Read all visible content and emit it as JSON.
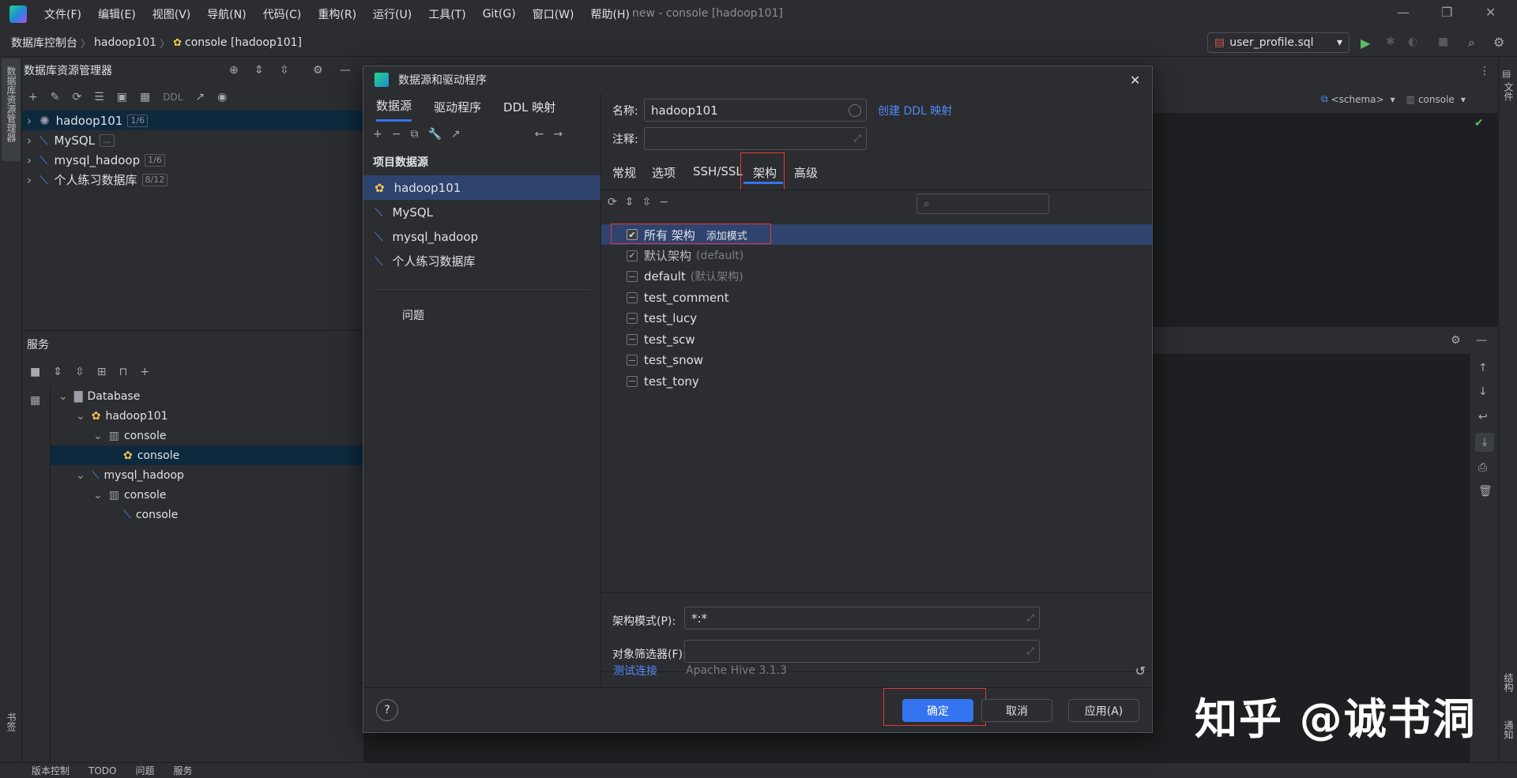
{
  "menu": [
    "文件(F)",
    "编辑(E)",
    "视图(V)",
    "导航(N)",
    "代码(C)",
    "重构(R)",
    "运行(U)",
    "工具(T)",
    "Git(G)",
    "窗口(W)",
    "帮助(H)"
  ],
  "window_title": "new - console [hadoop101]",
  "breadcrumb": [
    "数据库控制台",
    "hadoop101",
    "console [hadoop101]"
  ],
  "run_config": "user_profile.sql",
  "left_strip_label": "数据库资源管理器",
  "db_explorer": {
    "title": "数据库资源管理器",
    "toolbar_ddl": "DDL",
    "items": [
      {
        "name": "hadoop101",
        "badge": "1/6"
      },
      {
        "name": "MySQL",
        "badge": "..."
      },
      {
        "name": "mysql_hadoop",
        "badge": "1/6"
      },
      {
        "name": "个人练习数据库",
        "badge": "8/12"
      }
    ]
  },
  "services": {
    "title": "服务",
    "tree": [
      {
        "label": "Database",
        "level": 0
      },
      {
        "label": "hadoop101",
        "level": 1
      },
      {
        "label": "console",
        "level": 2
      },
      {
        "label": "console",
        "level": 3
      },
      {
        "label": "mysql_hadoop",
        "level": 1
      },
      {
        "label": "console",
        "level": 2
      },
      {
        "label": "console",
        "level": 3
      }
    ]
  },
  "editor": {
    "schema_selector": "<schema>",
    "console_selector": "console"
  },
  "right_strip": {
    "top": "文件",
    "bottom1": "结构",
    "bottom2": "通知"
  },
  "left_strip_bottom": "书签",
  "status_bar": [
    "版本控制",
    "TODO",
    "问题",
    "服务"
  ],
  "dialog": {
    "title": "数据源和驱动程序",
    "left_tabs": [
      "数据源",
      "驱动程序",
      "DDL 映射"
    ],
    "section_label": "项目数据源",
    "sources": [
      "hadoop101",
      "MySQL",
      "mysql_hadoop",
      "个人练习数据库"
    ],
    "problems": "问题",
    "name_label": "名称:",
    "name_value": "hadoop101",
    "create_ddl": "创建 DDL 映射",
    "comment_label": "注释:",
    "sub_tabs": [
      "常规",
      "选项",
      "SSH/SSL",
      "架构",
      "高级"
    ],
    "schemas": [
      {
        "label": "所有 架构",
        "extra": "添加模式",
        "state": "checked"
      },
      {
        "label": "默认架构",
        "extra": "(default)",
        "state": "checked-muted"
      },
      {
        "label": "default",
        "extra": "(默认架构)",
        "state": "dash"
      },
      {
        "label": "test_comment",
        "extra": "",
        "state": "dash"
      },
      {
        "label": "test_lucy",
        "extra": "",
        "state": "dash"
      },
      {
        "label": "test_scw",
        "extra": "",
        "state": "dash"
      },
      {
        "label": "test_snow",
        "extra": "",
        "state": "dash"
      },
      {
        "label": "test_tony",
        "extra": "",
        "state": "dash"
      }
    ],
    "schema_pattern_label": "架构模式(P):",
    "schema_pattern_value": "*:*",
    "object_filter_label": "对象筛选器(F):",
    "test_connection": "测试连接",
    "driver_version": "Apache Hive 3.1.3",
    "buttons": {
      "ok": "确定",
      "cancel": "取消",
      "apply": "应用(A)"
    },
    "help": "?"
  },
  "watermark": "知乎 @诚书洞",
  "colors": {
    "accent": "#3574f0",
    "selection": "#2e436e",
    "highlight_box": "#e53935"
  }
}
